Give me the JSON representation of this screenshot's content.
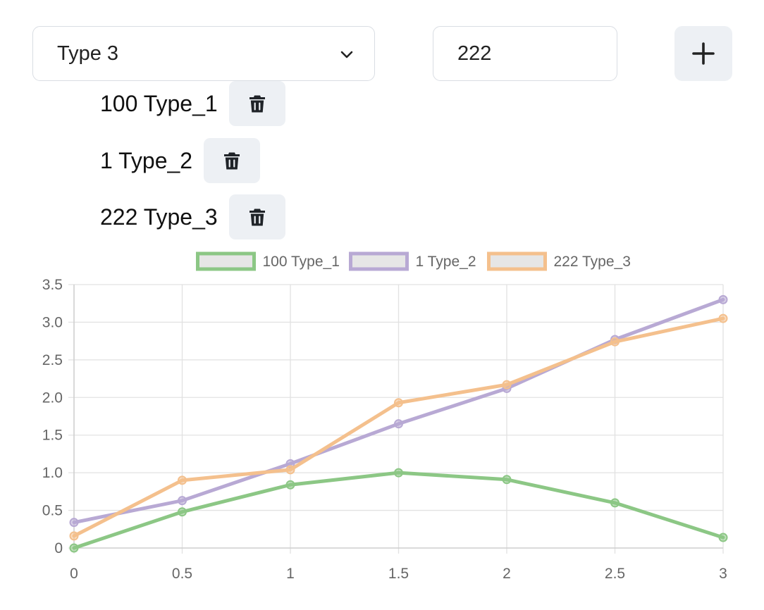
{
  "form": {
    "type_select": {
      "selected": "Type 3",
      "options": [
        "Type 3"
      ]
    },
    "value_input": {
      "value": "222"
    },
    "add_button_icon": "plus-icon",
    "delete_button_icon": "trash-icon"
  },
  "entries": [
    {
      "label": "100 Type_1"
    },
    {
      "label": "1 Type_2"
    },
    {
      "label": "222 Type_3"
    }
  ],
  "chart_data": {
    "type": "line",
    "x": [
      0,
      0.5,
      1,
      1.5,
      2,
      2.5,
      3
    ],
    "xticks": [
      "0",
      "0.5",
      "1",
      "1.5",
      "2",
      "2.5",
      "3"
    ],
    "yticks": [
      "0",
      "0.5",
      "1.0",
      "1.5",
      "2.0",
      "2.5",
      "3.0",
      "3.5"
    ],
    "xlim": [
      0,
      3
    ],
    "ylim": [
      0,
      3.5
    ],
    "grid": true,
    "legend_position": "top-center",
    "series": [
      {
        "name": "100 Type_1",
        "color": "#8cc785",
        "values": [
          0,
          0.48,
          0.84,
          1.0,
          0.91,
          0.6,
          0.14
        ]
      },
      {
        "name": "1 Type_2",
        "color": "#b8a9d4",
        "values": [
          0.34,
          0.63,
          1.12,
          1.65,
          2.12,
          2.77,
          3.3
        ]
      },
      {
        "name": "222 Type_3",
        "color": "#f4c08d",
        "values": [
          0.16,
          0.9,
          1.04,
          1.93,
          2.17,
          2.74,
          3.05
        ]
      }
    ]
  }
}
